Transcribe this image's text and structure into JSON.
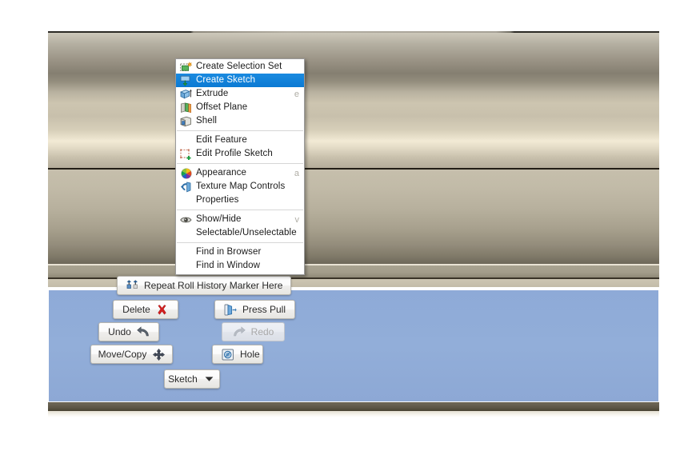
{
  "app": {
    "scene_description": "CAD 3D viewport showing a brushed-metal cylindrical part",
    "accent_color": "#0b7ad3",
    "panel_color": "#8fabd8",
    "button_face_color": "#fbfbfb"
  },
  "context_menu": {
    "name": "body-context-menu",
    "groups": [
      {
        "items": [
          {
            "label": "Create Selection Set",
            "icon": "create-selection-set-icon",
            "accel": "",
            "selected": false,
            "enabled": true
          },
          {
            "label": "Create Sketch",
            "icon": "create-sketch-icon",
            "accel": "",
            "selected": true,
            "enabled": true
          },
          {
            "label": "Extrude",
            "icon": "extrude-icon",
            "accel": "e",
            "selected": false,
            "enabled": true
          },
          {
            "label": "Offset Plane",
            "icon": "offset-plane-icon",
            "accel": "",
            "selected": false,
            "enabled": true
          },
          {
            "label": "Shell",
            "icon": "shell-icon",
            "accel": "",
            "selected": false,
            "enabled": true
          }
        ]
      },
      {
        "items": [
          {
            "label": "Edit Feature",
            "icon": "",
            "accel": "",
            "selected": false,
            "enabled": true
          },
          {
            "label": "Edit Profile Sketch",
            "icon": "edit-profile-sketch-icon",
            "accel": "",
            "selected": false,
            "enabled": true
          }
        ]
      },
      {
        "items": [
          {
            "label": "Appearance",
            "icon": "appearance-icon",
            "accel": "a",
            "selected": false,
            "enabled": true
          },
          {
            "label": "Texture Map Controls",
            "icon": "texture-map-controls-icon",
            "accel": "",
            "selected": false,
            "enabled": true
          },
          {
            "label": "Properties",
            "icon": "",
            "accel": "",
            "selected": false,
            "enabled": true
          }
        ]
      },
      {
        "items": [
          {
            "label": "Show/Hide",
            "icon": "eye-icon",
            "accel": "v",
            "selected": false,
            "enabled": true
          },
          {
            "label": "Selectable/Unselectable",
            "icon": "",
            "accel": "",
            "selected": false,
            "enabled": true
          }
        ]
      },
      {
        "items": [
          {
            "label": "Find in Browser",
            "icon": "",
            "accel": "",
            "selected": false,
            "enabled": true
          },
          {
            "label": "Find in Window",
            "icon": "",
            "accel": "",
            "selected": false,
            "enabled": true
          }
        ]
      }
    ]
  },
  "marking_menu": {
    "name": "quick-access-marking-menu",
    "buttons": {
      "repeat": {
        "label": "Repeat Roll History Marker Here",
        "icon": "roll-history-marker-icon",
        "enabled": true
      },
      "delete": {
        "label": "Delete",
        "icon": "delete-x-icon",
        "enabled": true
      },
      "press_pull": {
        "label": "Press Pull",
        "icon": "press-pull-icon",
        "enabled": true
      },
      "undo": {
        "label": "Undo",
        "icon": "undo-arrow-icon",
        "enabled": true
      },
      "redo": {
        "label": "Redo",
        "icon": "redo-arrow-icon",
        "enabled": false
      },
      "move_copy": {
        "label": "Move/Copy",
        "icon": "move-copy-icon",
        "enabled": true
      },
      "hole": {
        "label": "Hole",
        "icon": "hole-icon",
        "enabled": true
      },
      "sketch": {
        "label": "Sketch",
        "icon": "chevron-down-icon",
        "enabled": true
      }
    }
  }
}
